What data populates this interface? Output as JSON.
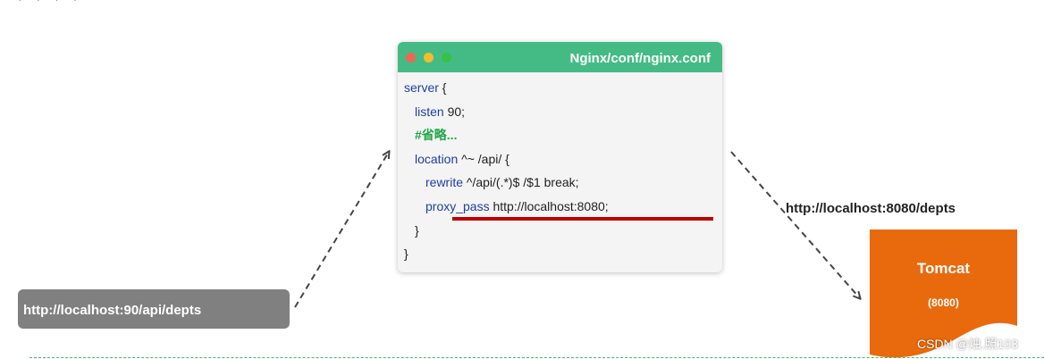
{
  "request": {
    "url": "http://localhost:90/api/depts"
  },
  "config_window": {
    "title": "Nginx/conf/nginx.conf",
    "lines": [
      {
        "keyword": "server",
        "rest": " {"
      },
      {
        "keyword": "listen",
        "rest": " 90;"
      },
      {
        "comment": "#省略..."
      },
      {
        "keyword": "location",
        "rest": " ^~ /api/ {"
      },
      {
        "keyword": "rewrite",
        "rest": " ^/api/(.*)$ /$1 break;"
      },
      {
        "keyword": "proxy_pass",
        "rest": " http://localhost:8080;"
      },
      {
        "rest": "}"
      },
      {
        "rest": "}"
      }
    ]
  },
  "target": {
    "url": "http://localhost:8080/depts"
  },
  "tomcat": {
    "name": "Tomcat",
    "port": "(8080)"
  },
  "watermark": "CSDN @烛.照103",
  "colors": {
    "title_bar": "#44bb84",
    "request_box": "#808080",
    "tomcat": "#e86a0c",
    "highlight": "#c00000",
    "keyword": "#1f3fa0",
    "comment": "#21a84a"
  }
}
